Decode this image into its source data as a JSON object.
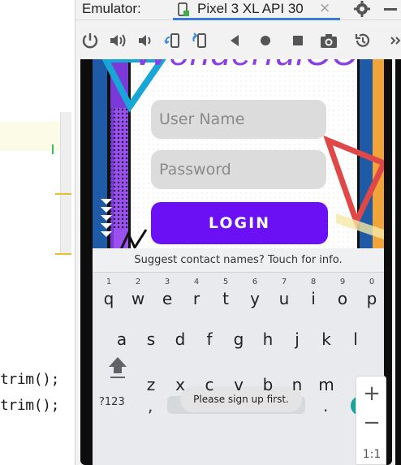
{
  "editor": {
    "code_lines": [
      "trim();",
      "trim();"
    ]
  },
  "emulator": {
    "title": "Emulator:",
    "tab_label": "Pixel 3 XL API 30",
    "tab_close": "×"
  },
  "toolbar": {
    "icons": [
      "power-icon",
      "volume-up-icon",
      "volume-down-icon",
      "rotate-left-icon",
      "rotate-right-icon",
      "back-icon",
      "home-icon",
      "overview-icon",
      "camera-icon",
      "snapshot-icon",
      "more-icon"
    ]
  },
  "app": {
    "logo_text": "WonderfulCC",
    "username_placeholder": "User Name",
    "password_placeholder": "Password",
    "login_label": "LOGIN"
  },
  "keyboard": {
    "suggestion": "Suggest contact names? Touch for info.",
    "row1": [
      {
        "key": "q",
        "hint": "1"
      },
      {
        "key": "w",
        "hint": "2"
      },
      {
        "key": "e",
        "hint": "3"
      },
      {
        "key": "r",
        "hint": "4"
      },
      {
        "key": "t",
        "hint": "5"
      },
      {
        "key": "y",
        "hint": "6"
      },
      {
        "key": "u",
        "hint": "7"
      },
      {
        "key": "i",
        "hint": "8"
      },
      {
        "key": "o",
        "hint": "9"
      },
      {
        "key": "p",
        "hint": "0"
      }
    ],
    "row2": [
      "a",
      "s",
      "d",
      "f",
      "g",
      "h",
      "j",
      "k",
      "l"
    ],
    "row3": [
      "z",
      "x",
      "c",
      "v",
      "b",
      "n",
      "m"
    ],
    "symbols_label": "?123",
    "comma": ",",
    "period": "."
  },
  "toast": "Please sign up first.",
  "zoom": {
    "plus": "+",
    "minus": "−",
    "one_to_one": "1:1"
  },
  "colors": {
    "login_button": "#6b0ff5",
    "accent_purple": "#8a3ee8",
    "keyboard_bg": "#e8eaed",
    "emulator_tab_underline": "#3a7bd5"
  }
}
